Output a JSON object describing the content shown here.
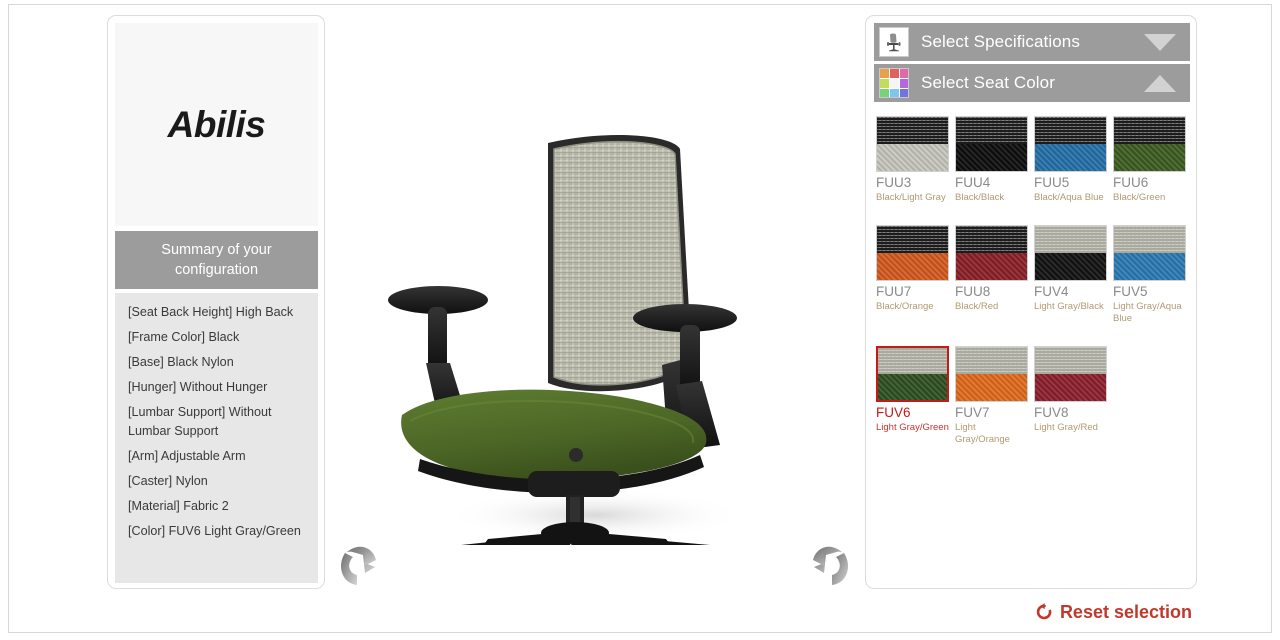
{
  "brand": {
    "logo_text": "Abilis"
  },
  "summary": {
    "header": "Summary of your configuration",
    "items": [
      "[Seat Back Height] High Back",
      "[Frame Color] Black",
      "[Base] Black Nylon",
      "[Hunger] Without Hunger",
      "[Lumbar Support] Without Lumbar Support",
      "[Arm] Adjustable Arm",
      "[Caster] Nylon",
      "[Material] Fabric 2",
      "[Color] FUV6 Light Gray/Green"
    ]
  },
  "viewer": {
    "rotate_left_icon": "rotate-left-arrow-icon",
    "rotate_right_icon": "rotate-right-arrow-icon",
    "product": {
      "mesh_color": "#c9cabc",
      "seat_color": "#4f6b28",
      "frame_color": "#1b1b1b"
    }
  },
  "panels": {
    "specifications": {
      "title": "Select Specifications",
      "icon": "chair-thumbnail-icon",
      "chevron": "chevron-down-icon",
      "expanded": false
    },
    "seat_color": {
      "title": "Select Seat Color",
      "icon": "color-grid-icon",
      "chevron": "chevron-up-icon",
      "expanded": true,
      "icon_colors": [
        "#e8a04a",
        "#e06060",
        "#e06aa8",
        "#c3dd5a",
        "#f4f4f4",
        "#b468e0",
        "#76d37a",
        "#7cc6ef",
        "#7272e0"
      ],
      "swatches": [
        {
          "code": "FUU3",
          "name": "Black/Light Gray",
          "top": "#1c1c1c",
          "bottom": "#c6c6bd",
          "selected": false
        },
        {
          "code": "FUU4",
          "name": "Black/Black",
          "top": "#1c1c1c",
          "bottom": "#0d0d0d",
          "selected": false
        },
        {
          "code": "FUU5",
          "name": "Black/Aqua Blue",
          "top": "#1c1c1c",
          "bottom": "#2470a8",
          "selected": false
        },
        {
          "code": "FUU6",
          "name": "Black/Green",
          "top": "#1c1c1c",
          "bottom": "#3d5c20",
          "selected": false
        },
        {
          "code": "FUU7",
          "name": "Black/Orange",
          "top": "#1c1c1c",
          "bottom": "#d4591f",
          "selected": false
        },
        {
          "code": "FUU8",
          "name": "Black/Red",
          "top": "#1c1c1c",
          "bottom": "#8c1f27",
          "selected": false
        },
        {
          "code": "FUV4",
          "name": "Light Gray/Black",
          "top": "#a9aa9d",
          "bottom": "#121212",
          "selected": false
        },
        {
          "code": "FUV5",
          "name": "Light Gray/Aqua Blue",
          "top": "#a9aa9d",
          "bottom": "#2b79b4",
          "selected": false
        },
        {
          "code": "FUV6",
          "name": "Light Gray/Green",
          "top": "#a9aa9d",
          "bottom": "#2f5020",
          "selected": true
        },
        {
          "code": "FUV7",
          "name": "Light Gray/Orange",
          "top": "#a9aa9d",
          "bottom": "#e06a1c",
          "selected": false
        },
        {
          "code": "FUV8",
          "name": "Light Gray/Red",
          "top": "#a9aa9d",
          "bottom": "#8c1f2d",
          "selected": false
        }
      ]
    }
  },
  "footer": {
    "reset_label": "Reset selection",
    "reset_icon": "refresh-icon",
    "reset_color": "#c0392b"
  }
}
